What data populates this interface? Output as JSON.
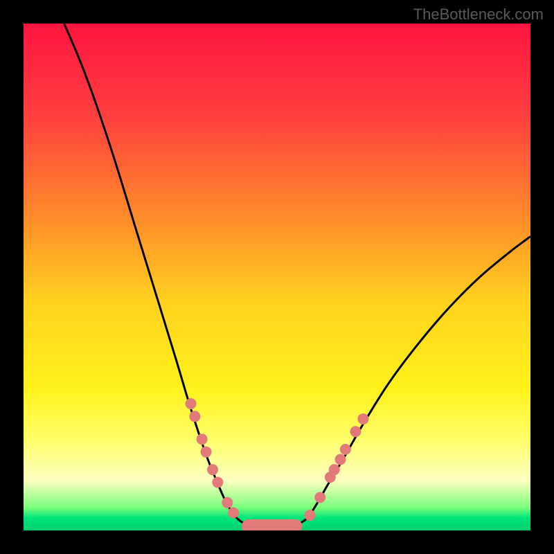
{
  "watermark": "TheBottleneck.com",
  "chart_data": {
    "type": "line",
    "title": "",
    "xlabel": "",
    "ylabel": "",
    "xlim": [
      0,
      100
    ],
    "ylim": [
      0,
      100
    ],
    "background": {
      "type": "vertical_gradient",
      "stops": [
        {
          "offset": 0,
          "color": "#ff153f"
        },
        {
          "offset": 0.18,
          "color": "#ff3f3f"
        },
        {
          "offset": 0.38,
          "color": "#ff8a2a"
        },
        {
          "offset": 0.55,
          "color": "#ffd21f"
        },
        {
          "offset": 0.72,
          "color": "#fff21a"
        },
        {
          "offset": 0.82,
          "color": "#ffff6a"
        },
        {
          "offset": 0.9,
          "color": "#ffffc0"
        },
        {
          "offset": 0.955,
          "color": "#7aff7a"
        },
        {
          "offset": 0.975,
          "color": "#00e57a"
        },
        {
          "offset": 1.0,
          "color": "#00d070"
        }
      ]
    },
    "series": [
      {
        "name": "v-curve",
        "stroke": "#000000",
        "stroke_width": 3,
        "points": [
          {
            "x": 8,
            "y": 100
          },
          {
            "x": 11,
            "y": 93
          },
          {
            "x": 14,
            "y": 85
          },
          {
            "x": 18,
            "y": 73
          },
          {
            "x": 22,
            "y": 60
          },
          {
            "x": 26,
            "y": 47
          },
          {
            "x": 30,
            "y": 34
          },
          {
            "x": 33,
            "y": 24
          },
          {
            "x": 36,
            "y": 15
          },
          {
            "x": 38,
            "y": 10
          },
          {
            "x": 40,
            "y": 5.5
          },
          {
            "x": 42,
            "y": 2.5
          },
          {
            "x": 44,
            "y": 1.2
          },
          {
            "x": 46,
            "y": 0.8
          },
          {
            "x": 48,
            "y": 0.8
          },
          {
            "x": 50,
            "y": 0.8
          },
          {
            "x": 52,
            "y": 0.8
          },
          {
            "x": 54,
            "y": 1.2
          },
          {
            "x": 56,
            "y": 2.5
          },
          {
            "x": 58,
            "y": 5.5
          },
          {
            "x": 60,
            "y": 9
          },
          {
            "x": 63,
            "y": 14
          },
          {
            "x": 67,
            "y": 21
          },
          {
            "x": 72,
            "y": 29
          },
          {
            "x": 78,
            "y": 37
          },
          {
            "x": 84,
            "y": 44
          },
          {
            "x": 90,
            "y": 50
          },
          {
            "x": 96,
            "y": 55
          },
          {
            "x": 100,
            "y": 58
          }
        ]
      }
    ],
    "markers_left": [
      {
        "x": 33.0,
        "y": 25.0
      },
      {
        "x": 33.8,
        "y": 22.5
      },
      {
        "x": 35.2,
        "y": 18.0
      },
      {
        "x": 36.0,
        "y": 15.5
      },
      {
        "x": 37.3,
        "y": 12.0
      },
      {
        "x": 38.3,
        "y": 9.5
      },
      {
        "x": 40.2,
        "y": 5.5
      },
      {
        "x": 41.4,
        "y": 3.5
      }
    ],
    "markers_right": [
      {
        "x": 56.5,
        "y": 3.0
      },
      {
        "x": 58.5,
        "y": 6.5
      },
      {
        "x": 60.5,
        "y": 10.5
      },
      {
        "x": 61.3,
        "y": 12.0
      },
      {
        "x": 62.5,
        "y": 14.0
      },
      {
        "x": 63.5,
        "y": 16.0
      },
      {
        "x": 65.5,
        "y": 19.5
      },
      {
        "x": 67.0,
        "y": 22.0
      }
    ],
    "plateau": {
      "name": "bottom-plateau",
      "color": "#e37a7a",
      "x_start": 43,
      "x_end": 55,
      "y": 0.8,
      "thickness": 2.8
    },
    "marker_style": {
      "color": "#e37a7a",
      "radius": 8
    }
  }
}
